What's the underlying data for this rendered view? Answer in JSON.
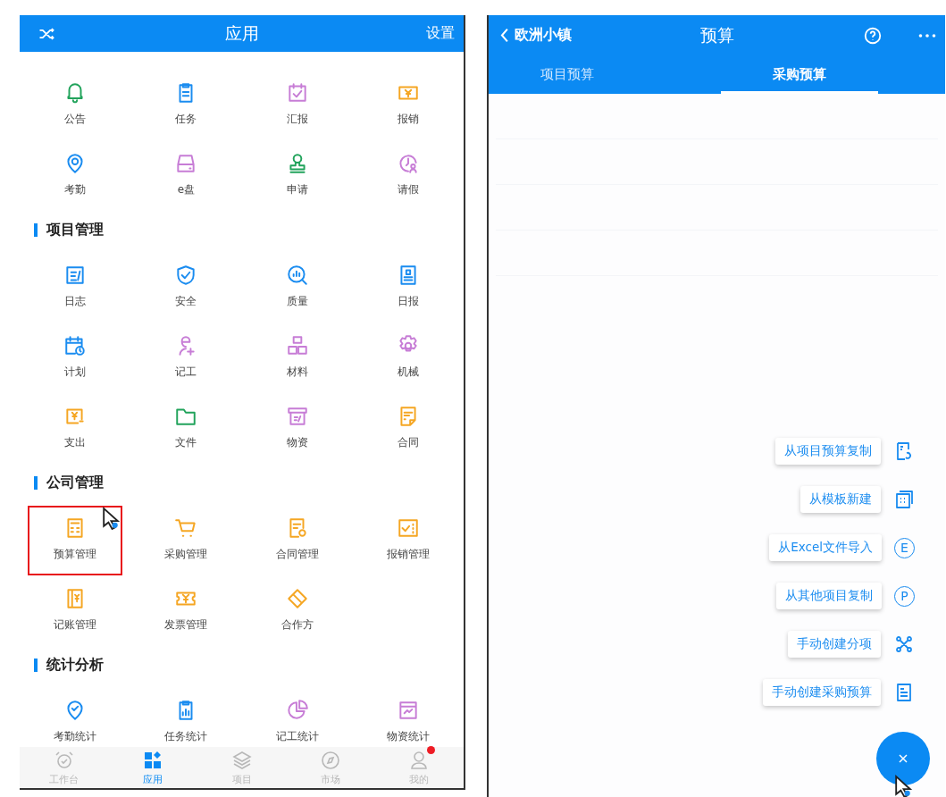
{
  "left": {
    "header": {
      "title": "应用",
      "action": "设置"
    },
    "sections": [
      {
        "items": [
          {
            "label": "公告",
            "color": "#21a35b",
            "highlighted": false
          },
          {
            "label": "任务",
            "color": "#1a8cf0",
            "highlighted": false
          },
          {
            "label": "汇报",
            "color": "#c77dd6",
            "highlighted": false
          },
          {
            "label": "报销",
            "color": "#f5a623",
            "highlighted": false
          },
          {
            "label": "考勤",
            "color": "#1a8cf0",
            "highlighted": false
          },
          {
            "label": "e盘",
            "color": "#c77dd6",
            "highlighted": false
          },
          {
            "label": "申请",
            "color": "#21a35b",
            "highlighted": false
          },
          {
            "label": "请假",
            "color": "#c77dd6",
            "highlighted": false
          }
        ]
      },
      {
        "title": "项目管理",
        "items": [
          {
            "label": "日志",
            "color": "#1a8cf0",
            "highlighted": false
          },
          {
            "label": "安全",
            "color": "#1a8cf0",
            "highlighted": false
          },
          {
            "label": "质量",
            "color": "#1a8cf0",
            "highlighted": false
          },
          {
            "label": "日报",
            "color": "#1a8cf0",
            "highlighted": false
          },
          {
            "label": "计划",
            "color": "#1a8cf0",
            "highlighted": false
          },
          {
            "label": "记工",
            "color": "#c77dd6",
            "highlighted": false
          },
          {
            "label": "材料",
            "color": "#c77dd6",
            "highlighted": false
          },
          {
            "label": "机械",
            "color": "#c77dd6",
            "highlighted": false
          },
          {
            "label": "支出",
            "color": "#f5a623",
            "highlighted": false
          },
          {
            "label": "文件",
            "color": "#21a35b",
            "highlighted": false
          },
          {
            "label": "物资",
            "color": "#c77dd6",
            "highlighted": false
          },
          {
            "label": "合同",
            "color": "#f5a623",
            "highlighted": false
          }
        ]
      },
      {
        "title": "公司管理",
        "items": [
          {
            "label": "预算管理",
            "color": "#f5a623",
            "highlighted": true
          },
          {
            "label": "采购管理",
            "color": "#f5a623",
            "highlighted": false
          },
          {
            "label": "合同管理",
            "color": "#f5a623",
            "highlighted": false
          },
          {
            "label": "报销管理",
            "color": "#f5a623",
            "highlighted": false
          },
          {
            "label": "记账管理",
            "color": "#f5a623",
            "highlighted": false
          },
          {
            "label": "发票管理",
            "color": "#f5a623",
            "highlighted": false
          },
          {
            "label": "合作方",
            "color": "#f5a623",
            "highlighted": false
          }
        ]
      },
      {
        "title": "统计分析",
        "items": [
          {
            "label": "考勤统计",
            "color": "#1a8cf0",
            "highlighted": false
          },
          {
            "label": "任务统计",
            "color": "#1a8cf0",
            "highlighted": false
          },
          {
            "label": "记工统计",
            "color": "#c77dd6",
            "highlighted": false
          },
          {
            "label": "物资统计",
            "color": "#c77dd6",
            "highlighted": false
          }
        ]
      }
    ],
    "nav": [
      {
        "label": "工作台",
        "selected": false,
        "dot": false
      },
      {
        "label": "应用",
        "selected": true,
        "dot": false
      },
      {
        "label": "项目",
        "selected": false,
        "dot": false
      },
      {
        "label": "市场",
        "selected": false,
        "dot": false
      },
      {
        "label": "我的",
        "selected": false,
        "dot": true
      }
    ]
  },
  "right": {
    "header": {
      "back": "欧洲小镇",
      "title": "预算"
    },
    "tabs": [
      {
        "label": "项目预算",
        "selected": false
      },
      {
        "label": "采购预算",
        "selected": true
      }
    ],
    "menu": [
      {
        "label": "从项目预算复制"
      },
      {
        "label": "从模板新建"
      },
      {
        "label": "从Excel文件导入",
        "icon_text": "E"
      },
      {
        "label": "从其他项目复制",
        "icon_text": "P"
      },
      {
        "label": "手动创建分项"
      },
      {
        "label": "手动创建采购预算"
      }
    ]
  }
}
